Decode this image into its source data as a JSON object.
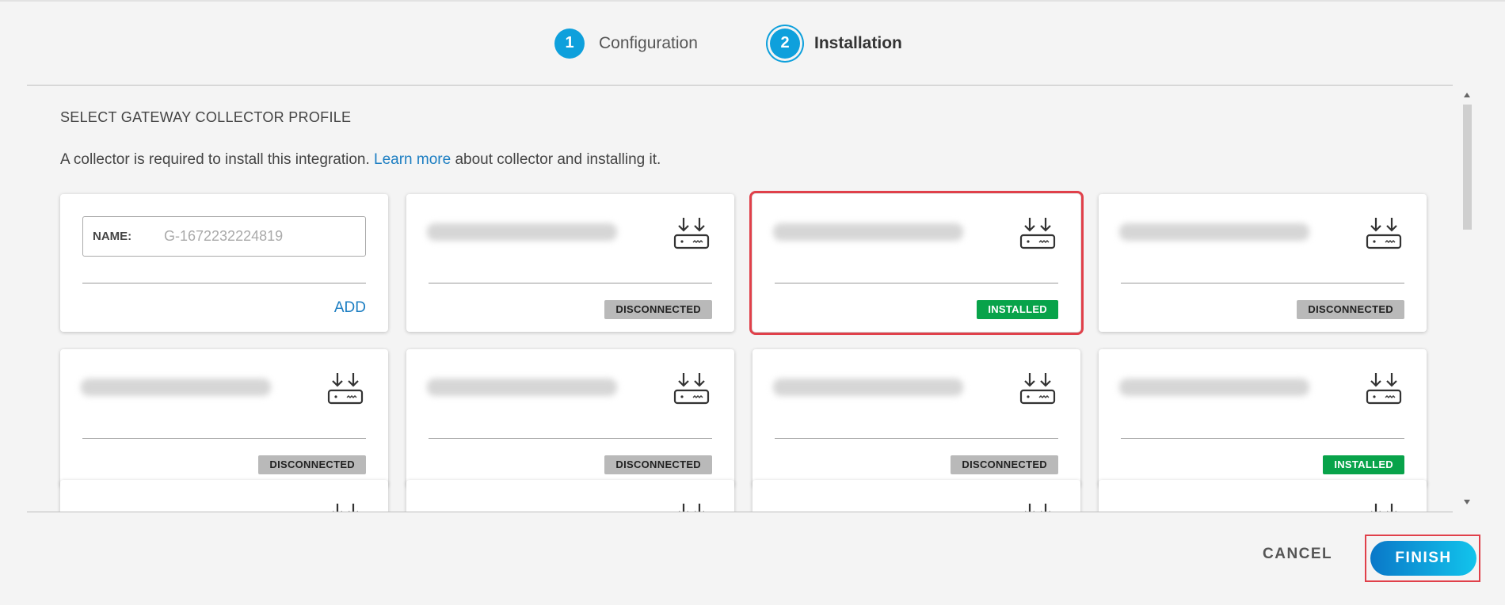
{
  "stepper": {
    "steps": [
      {
        "number": "1",
        "label": "Configuration",
        "active": false
      },
      {
        "number": "2",
        "label": "Installation",
        "active": true
      }
    ]
  },
  "section": {
    "title": "SELECT GATEWAY COLLECTOR PROFILE",
    "intro_before": "A collector is required to install this integration. ",
    "intro_link": "Learn more",
    "intro_after": " about collector and installing it."
  },
  "new_collector": {
    "name_label": "NAME:",
    "name_placeholder": "G-1672232224819",
    "add_label": "ADD"
  },
  "collectors": [
    {
      "status": "DISCONNECTED",
      "selected": false,
      "icon": "gateway-icon"
    },
    {
      "status": "INSTALLED",
      "selected": true,
      "icon": "gateway-icon"
    },
    {
      "status": "DISCONNECTED",
      "selected": false,
      "icon": "gateway-icon"
    },
    {
      "status": "DISCONNECTED",
      "selected": false,
      "icon": "gateway-icon"
    },
    {
      "status": "DISCONNECTED",
      "selected": false,
      "icon": "gateway-icon"
    },
    {
      "status": "DISCONNECTED",
      "selected": false,
      "icon": "gateway-icon"
    },
    {
      "status": "INSTALLED",
      "selected": false,
      "icon": "gateway-icon"
    }
  ],
  "footer": {
    "cancel_label": "CANCEL",
    "finish_label": "FINISH"
  },
  "colors": {
    "accent": "#0ea0dc",
    "link": "#1c7ec2",
    "installed": "#08a34a",
    "disconnected": "#b9b9b9",
    "highlight": "#e0404a"
  }
}
